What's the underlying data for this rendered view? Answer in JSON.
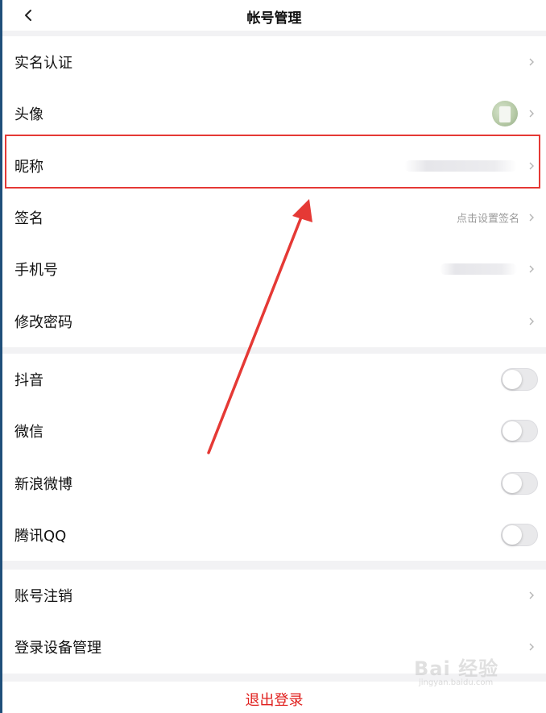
{
  "header": {
    "title": "帐号管理",
    "back_icon": "chevron-left-icon"
  },
  "account": {
    "items": [
      {
        "label": "实名认证"
      },
      {
        "label": "头像"
      },
      {
        "label": "昵称"
      },
      {
        "label": "签名",
        "hint": "点击设置签名"
      },
      {
        "label": "手机号"
      },
      {
        "label": "修改密码"
      }
    ]
  },
  "bindings": {
    "items": [
      {
        "label": "抖音",
        "enabled": false
      },
      {
        "label": "微信",
        "enabled": false
      },
      {
        "label": "新浪微博",
        "enabled": false
      },
      {
        "label": "腾讯QQ",
        "enabled": false
      }
    ]
  },
  "more": {
    "items": [
      {
        "label": "账号注销"
      },
      {
        "label": "登录设备管理"
      }
    ]
  },
  "logout": {
    "label": "退出登录"
  },
  "watermark": {
    "text": "Bai 经验",
    "sub": "jingyan.baidu.com"
  },
  "colors": {
    "accent_red": "#e0201e",
    "annotation_red": "#e53935"
  }
}
